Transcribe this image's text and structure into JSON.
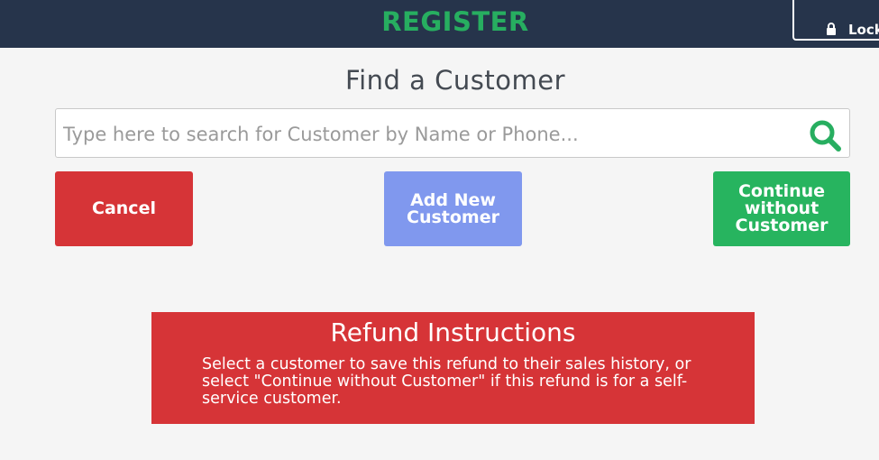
{
  "header": {
    "title": "REGISTER",
    "lock_label": "Lock"
  },
  "main": {
    "heading": "Find a Customer",
    "search": {
      "placeholder": "Type here to search for Customer by Name or Phone...",
      "value": ""
    },
    "buttons": {
      "cancel": "Cancel",
      "add_new_customer": "Add New Customer",
      "continue_without_customer": "Continue without Customer"
    },
    "refund": {
      "title": "Refund Instructions",
      "text": "Select a customer to save this refund to their sales history, or select \"Continue without Customer\" if this refund is for a self-service customer."
    }
  },
  "colors": {
    "header_bg": "#26344b",
    "brand_green": "#27ae60",
    "cancel_red": "#d63437",
    "add_blue": "#8098ee",
    "continue_green": "#27b45f"
  },
  "icons": {
    "lock": "lock-icon",
    "search": "search-icon"
  }
}
